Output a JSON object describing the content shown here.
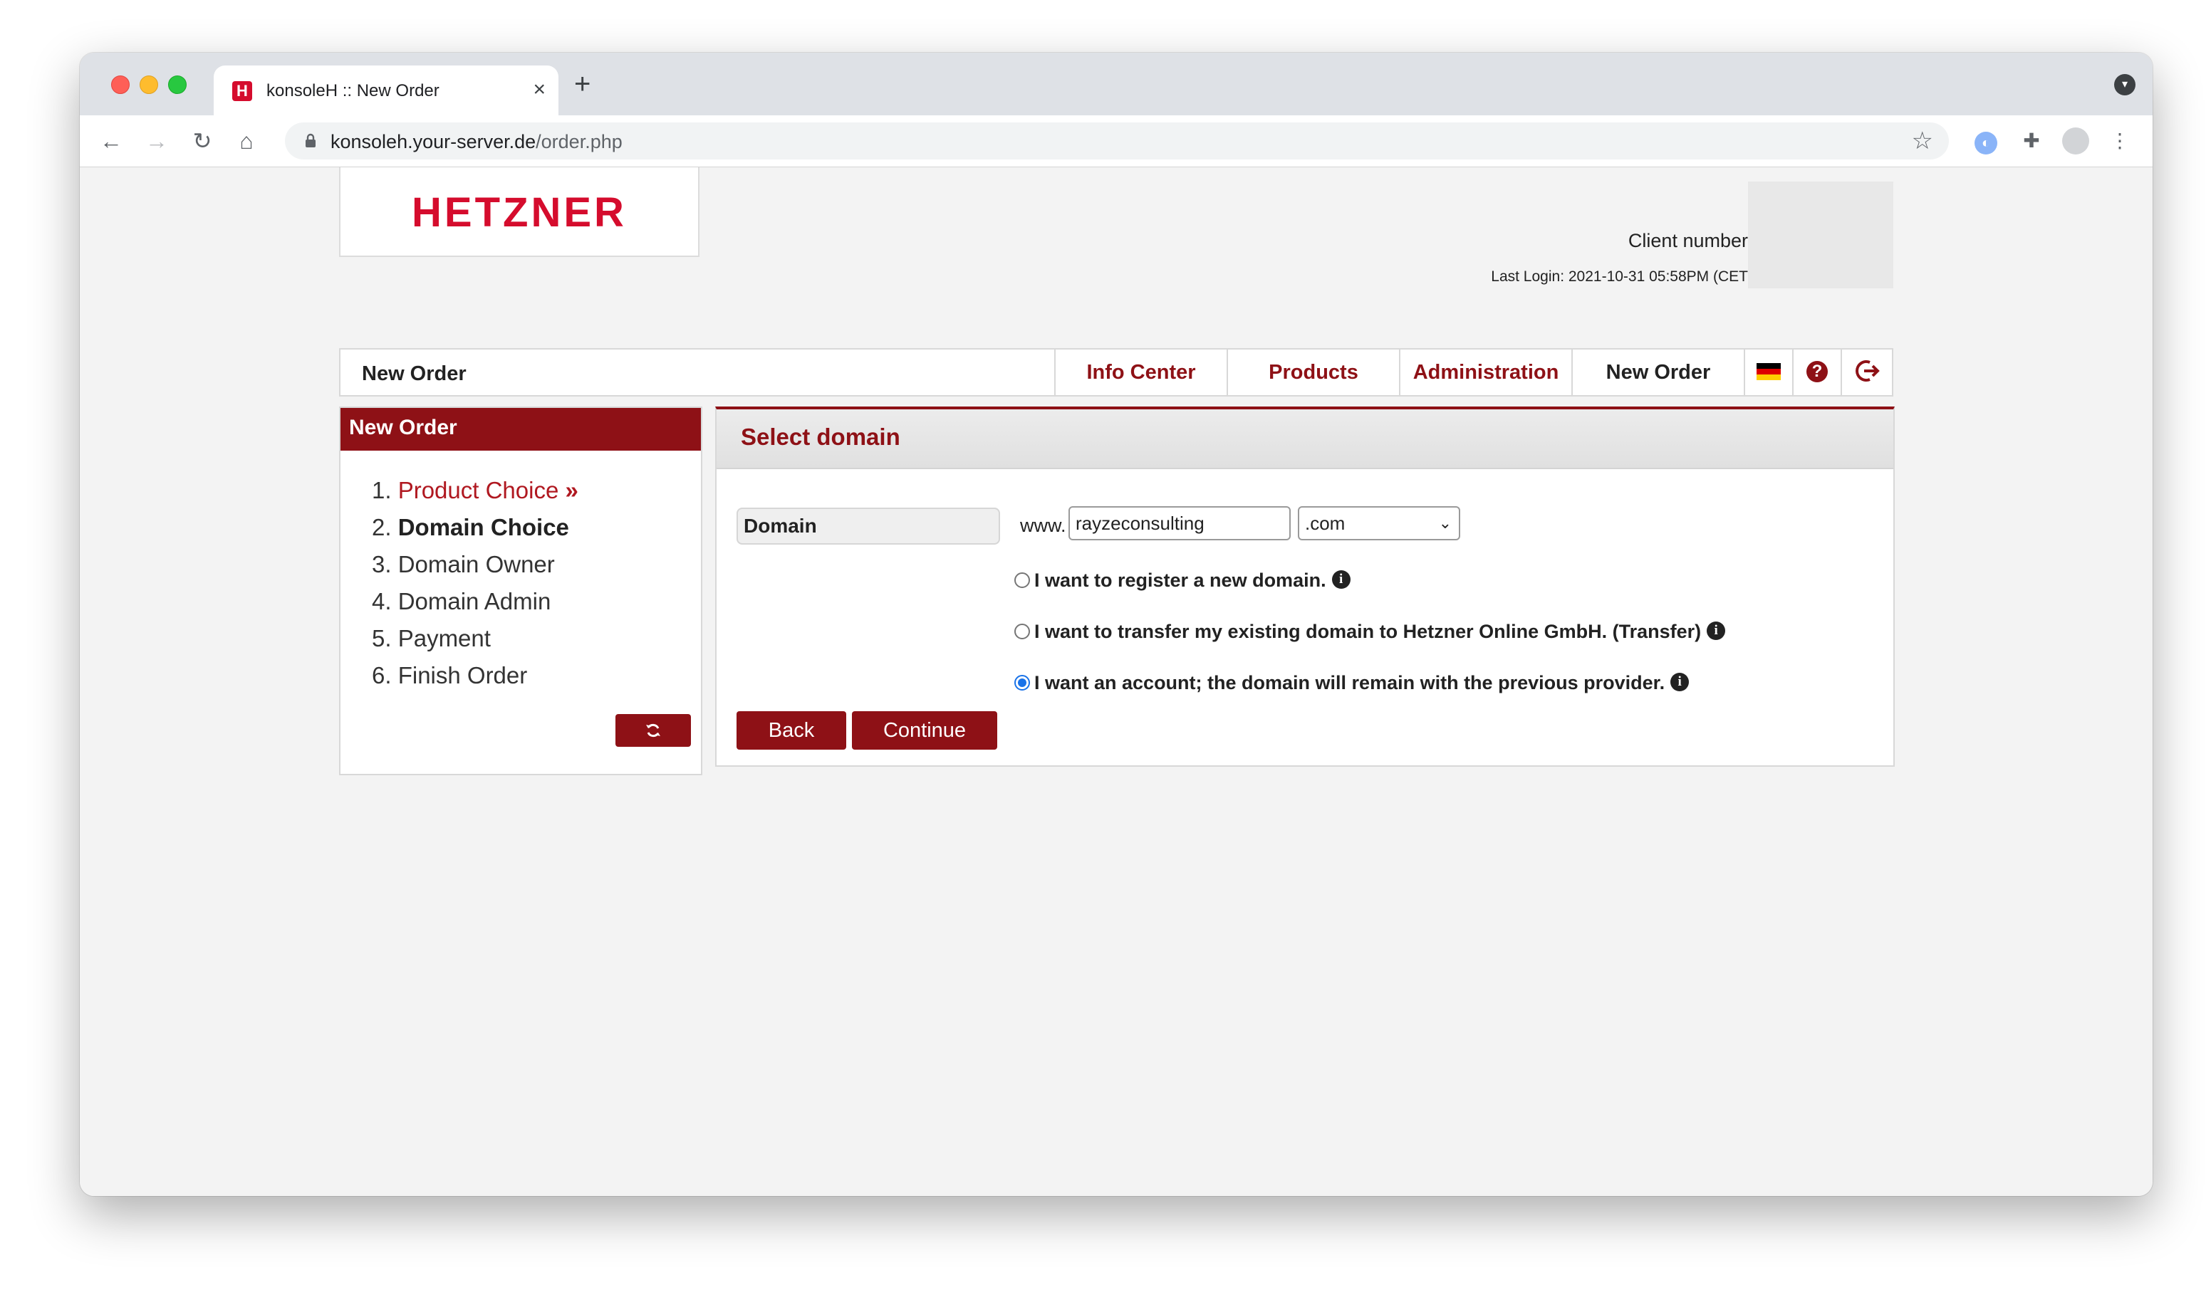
{
  "browser": {
    "tab_title": "konsoleH :: New Order",
    "tab_favicon": "H",
    "url_host": "konsoleh.your-server.de",
    "url_path": "/order.php"
  },
  "header": {
    "logo": "HETZNER",
    "client_number_label": "Client number",
    "last_login": "Last Login: 2021-10-31 05:58PM (CET"
  },
  "mainnav": {
    "title": "New Order",
    "tabs": [
      {
        "label": "Info Center"
      },
      {
        "label": "Products"
      },
      {
        "label": "Administration"
      },
      {
        "label": "New Order"
      }
    ],
    "flag_colors": [
      "#000000",
      "#dd0000",
      "#ffce00"
    ],
    "brand_color": "#8e1116"
  },
  "sidebar": {
    "title": "New Order",
    "steps": [
      {
        "num": "1.",
        "label": "Product Choice",
        "suffix": " »"
      },
      {
        "num": "2.",
        "label": "Domain Choice"
      },
      {
        "num": "3.",
        "label": "Domain Owner"
      },
      {
        "num": "4.",
        "label": "Domain Admin"
      },
      {
        "num": "5.",
        "label": "Payment"
      },
      {
        "num": "6.",
        "label": "Finish Order"
      }
    ]
  },
  "content": {
    "title": "Select domain",
    "domain_label": "Domain",
    "www_prefix": "www.",
    "domain_value": "rayzeconsulting",
    "tld_selected": ".com",
    "options": [
      {
        "label": "I want to register a new domain.",
        "checked": false
      },
      {
        "label": "I want to transfer my existing domain to Hetzner Online GmbH. (Transfer)",
        "checked": false
      },
      {
        "label": "I want an account; the domain will remain with the previous provider.",
        "checked": true
      }
    ],
    "back_label": "Back",
    "continue_label": "Continue"
  }
}
